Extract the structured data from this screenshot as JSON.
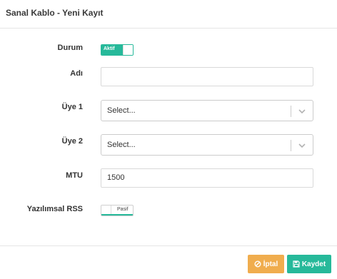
{
  "header": {
    "title": "Sanal Kablo - Yeni Kayıt"
  },
  "form": {
    "durum": {
      "label": "Durum",
      "toggle_text": "Aktif",
      "state": "on"
    },
    "adi": {
      "label": "Adı",
      "value": ""
    },
    "uye1": {
      "label": "Üye 1",
      "placeholder": "Select..."
    },
    "uye2": {
      "label": "Üye 2",
      "placeholder": "Select..."
    },
    "mtu": {
      "label": "MTU",
      "value": "1500"
    },
    "yazilimsal_rss": {
      "label": "Yazılımsal RSS",
      "toggle_text": "Pasif",
      "state": "off"
    }
  },
  "footer": {
    "cancel_label": "İptal",
    "save_label": "Kaydet"
  },
  "colors": {
    "primary": "#26b99a",
    "warning": "#f0ad4e"
  },
  "icons": {
    "cancel": "ban-icon",
    "save": "floppy-disk-icon",
    "dropdown": "chevron-down-icon"
  }
}
